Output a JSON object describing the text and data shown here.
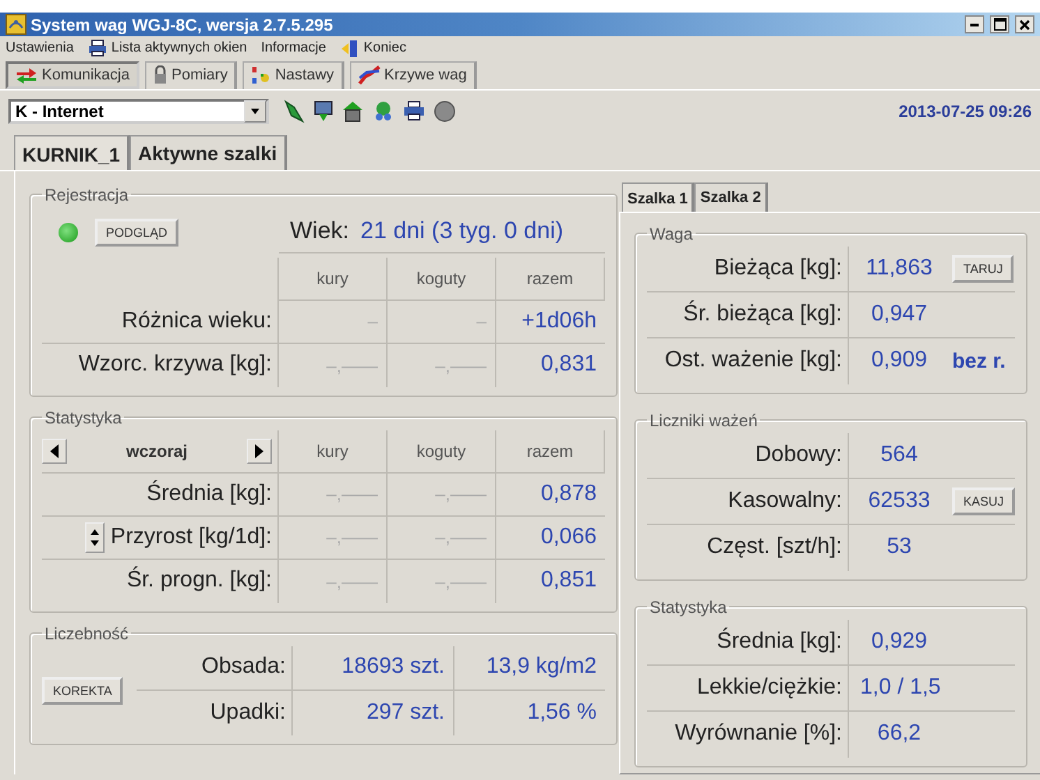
{
  "window": {
    "title": "System wag WGJ-8C, wersja 2.7.5.295"
  },
  "menu": [
    {
      "label": "Ustawienia",
      "kind": "plain"
    },
    {
      "label": "Lista aktywnych okien",
      "kind": "printer"
    },
    {
      "label": "Informacje",
      "kind": "plain"
    },
    {
      "label": "Koniec",
      "kind": "exit"
    }
  ],
  "main_tabs": [
    {
      "label": "Komunikacja",
      "selected": true,
      "kind": "arrows"
    },
    {
      "label": "Pomiary",
      "selected": false,
      "kind": "lock"
    },
    {
      "label": "Nastawy",
      "selected": false,
      "kind": "dots"
    },
    {
      "label": "Krzywe wag",
      "selected": false,
      "kind": "curve"
    }
  ],
  "connection": {
    "value": "K - Internet"
  },
  "datetime": "2013-07-25 09:26",
  "house_tabs": [
    {
      "label": "KURNIK_1",
      "selected": true
    },
    {
      "label": "Aktywne szalki",
      "selected": false
    }
  ],
  "rejestracja": {
    "title": "Rejestracja",
    "online": true,
    "button": "PODGLĄD",
    "age_label": "Wiek:",
    "age_value": "21 dni (3 tyg. 0 dni)",
    "columns": [
      "kury",
      "koguty",
      "razem"
    ],
    "rows": [
      {
        "label": "Różnica wieku:",
        "cells": [
          "–",
          "–",
          "+1d06h"
        ]
      },
      {
        "label": "Wzorc. krzywa [kg]:",
        "cells": [
          "–,——",
          "–,——",
          "0,831"
        ]
      }
    ]
  },
  "statystyka": {
    "title": "Statystyka",
    "period": "wczoraj",
    "columns": [
      "kury",
      "koguty",
      "razem"
    ],
    "rows": [
      {
        "label": "Średnia [kg]:",
        "kind": "plain",
        "cells": [
          "–,——",
          "–,——",
          "0,878"
        ]
      },
      {
        "label": "Przyrost [kg/1d]:",
        "kind": "spin",
        "cells": [
          "–,——",
          "–,——",
          "0,066"
        ]
      },
      {
        "label": "Śr. progn. [kg]:",
        "kind": "plain",
        "cells": [
          "–,——",
          "–,——",
          "0,851"
        ]
      }
    ]
  },
  "liczebnosc": {
    "title": "Liczebność",
    "button": "KOREKTA",
    "rows": [
      {
        "label": "Obsada:",
        "cells": [
          "18693 szt.",
          "13,9 kg/m2"
        ]
      },
      {
        "label": "Upadki:",
        "cells": [
          "297 szt.",
          "1,56 %"
        ]
      }
    ]
  },
  "scale_tabs": [
    {
      "label": "Szalka 1",
      "selected": true
    },
    {
      "label": "Szalka 2",
      "selected": false
    }
  ],
  "scale_groups": [
    {
      "title": "Waga",
      "rows": [
        {
          "label": "Bieżąca [kg]:",
          "value": "11,863",
          "button": "TARUJ"
        },
        {
          "label": "Śr. bieżąca [kg]:",
          "value": "0,947"
        },
        {
          "label": "Ost. ważenie [kg]:",
          "value": "0,909",
          "suffix": "bez r."
        }
      ]
    },
    {
      "title": "Liczniki ważeń",
      "rows": [
        {
          "label": "Dobowy:",
          "value": "564"
        },
        {
          "label": "Kasowalny:",
          "value": "62533",
          "button": "KASUJ"
        },
        {
          "label": "Częst. [szt/h]:",
          "value": "53"
        }
      ]
    },
    {
      "title": "Statystyka",
      "rows": [
        {
          "label": "Średnia [kg]:",
          "value": "0,929"
        },
        {
          "label": "Lekkie/ciężkie:",
          "value": "1,0 / 1,5"
        },
        {
          "label": "Wyrównanie [%]:",
          "value": "66,2"
        }
      ]
    }
  ]
}
